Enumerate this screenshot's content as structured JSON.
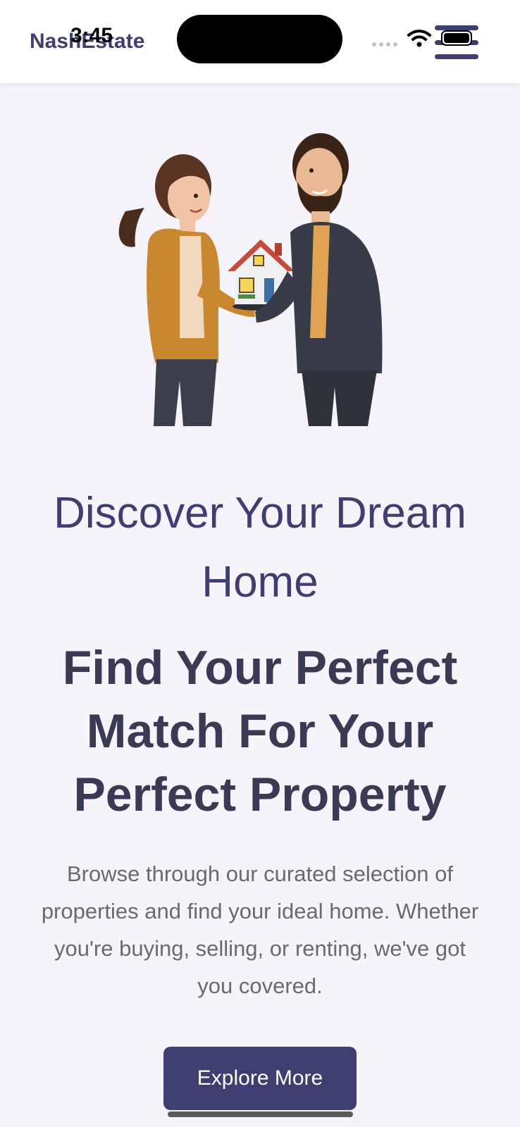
{
  "status_bar": {
    "time": "3:45"
  },
  "header": {
    "brand": "NashEstate",
    "menu_icon": "hamburger-menu-icon"
  },
  "hero": {
    "illustration": "couple-holding-house-illustration",
    "subtitle": "Discover Your Dream Home",
    "headline": "Find Your Perfect Match For Your Perfect Property",
    "description": "Browse through our curated selection of properties and find your ideal home. Whether you're buying, selling, or renting, we've got you covered.",
    "cta_label": "Explore More"
  },
  "colors": {
    "brand": "#3e3f70",
    "background": "#f7f3fb",
    "headline": "#3a3a55",
    "body_text": "#6a6a6a"
  }
}
